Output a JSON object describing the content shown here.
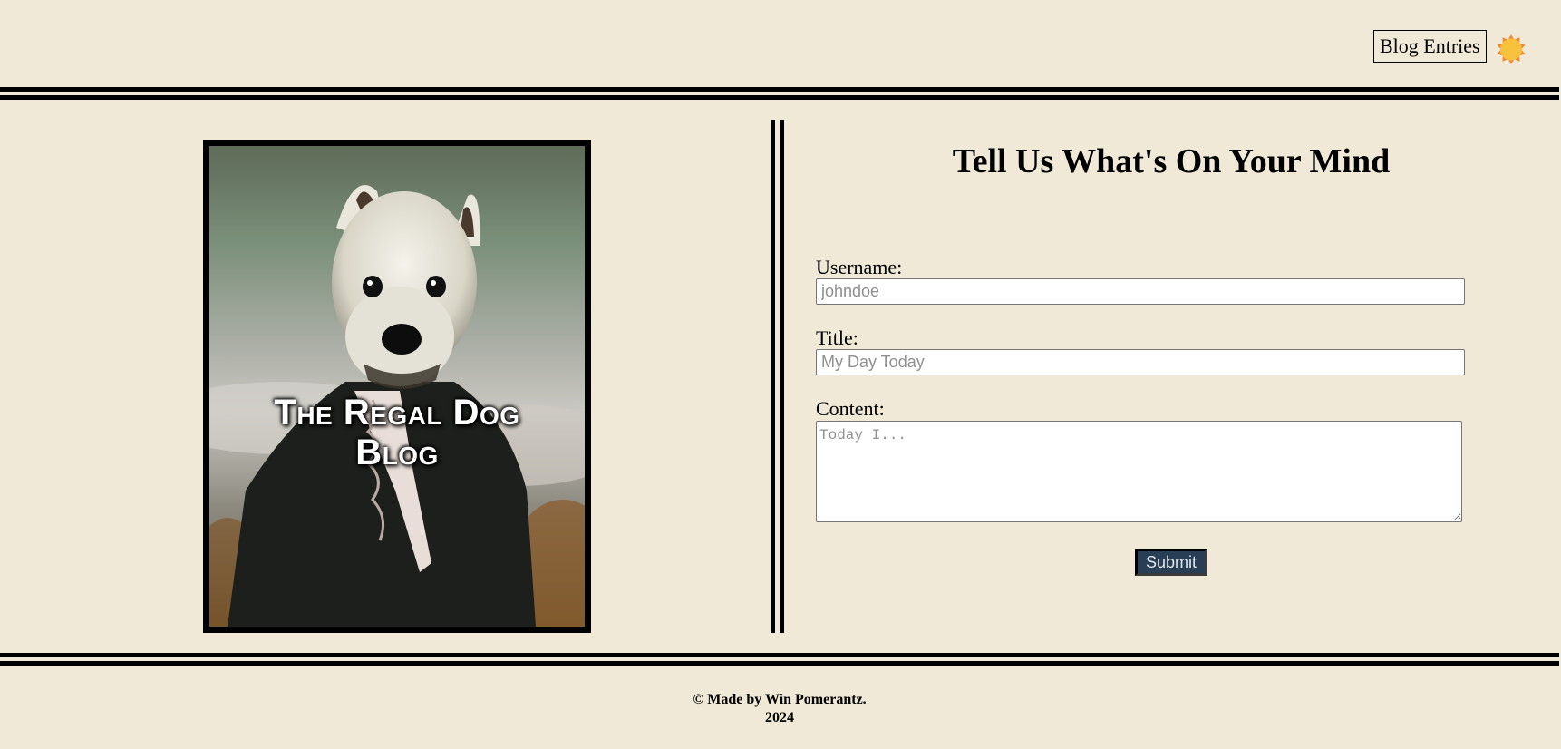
{
  "header": {
    "nav_link_label": "Blog Entries",
    "theme_toggle_icon": "sun-icon"
  },
  "poster": {
    "title_line1": "The Regal Dog",
    "title_line2": "Blog"
  },
  "form": {
    "heading": "Tell Us What's On Your Mind",
    "username_label": "Username:",
    "username_placeholder": "johndoe",
    "title_label": "Title:",
    "title_placeholder": "My Day Today",
    "content_label": "Content:",
    "content_placeholder": "Today I...",
    "submit_label": "Submit"
  },
  "footer": {
    "credit": "© Made by Win Pomerantz.",
    "year": "2024"
  },
  "colors": {
    "background": "#f1e9d7",
    "submit_bg": "#283e55",
    "sun_fill": "#f9c23c",
    "sun_outline": "#f08a32"
  }
}
